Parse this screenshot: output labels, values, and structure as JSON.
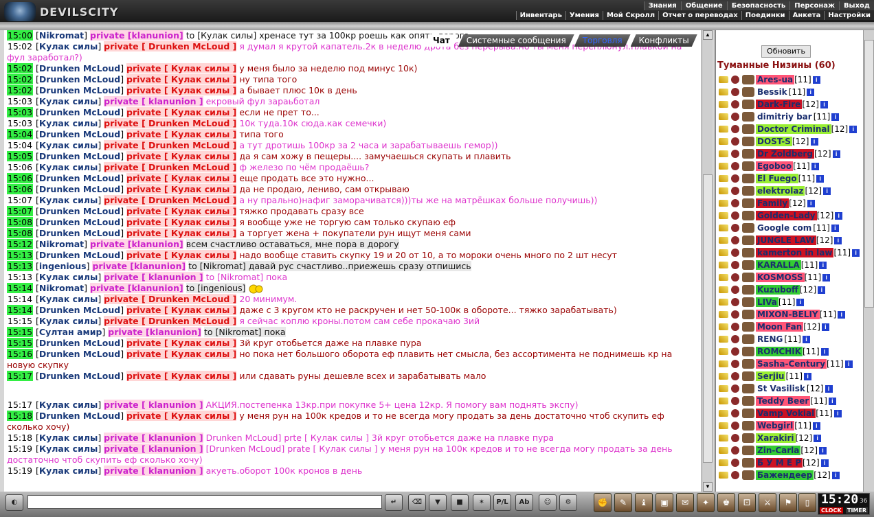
{
  "app": {
    "title": "DEVILSCITY"
  },
  "menu_top": [
    "Знания",
    "Общение",
    "Безопасность",
    "Персонаж",
    "Выход"
  ],
  "menu_sub": [
    "Инвентарь",
    "Умения",
    "Мой Скролл",
    "Отчет о переводах",
    "Поединки",
    "Анкета",
    "Настройки"
  ],
  "tabs": [
    {
      "label": "Чат",
      "active": true
    },
    {
      "label": "Системные сообщения",
      "active": false
    },
    {
      "label": "Торговля",
      "active": false
    },
    {
      "label": "Конфликты",
      "active": false
    }
  ],
  "chat": [
    {
      "time": "15:00",
      "g": 1,
      "name": "Nikromat",
      "priv": "private [klanunion]",
      "pc": "pm",
      "msg": "to [Кулак силы] хренасе тут за 100кр роешь как опять дорога",
      "mc": "m3"
    },
    {
      "time": "15:02",
      "g": 0,
      "name": "Кулак силы",
      "priv": "private [ Drunken McLoud ]",
      "pc": "p",
      "msg": "я думал я крутой капатель.2к в неделю дрота без перерыва.но ты меня переплюнул.плавкой на фул заработал?)",
      "mc": "m2"
    },
    {
      "time": "15:02",
      "g": 1,
      "name": "Drunken McLoud",
      "priv": "private [ Кулак силы ]",
      "pc": "p",
      "msg": "у меня было за неделю под минус 10к)",
      "mc": "m1"
    },
    {
      "time": "15:02",
      "g": 1,
      "name": "Drunken McLoud",
      "priv": "private [ Кулак силы ]",
      "pc": "p",
      "msg": "ну типа того",
      "mc": "m1"
    },
    {
      "time": "15:02",
      "g": 1,
      "name": "Drunken McLoud",
      "priv": "private [ Кулак силы ]",
      "pc": "p",
      "msg": "а бывает плюс 10к в день",
      "mc": "m1"
    },
    {
      "time": "15:03",
      "g": 0,
      "name": "Кулак силы",
      "priv": "private [ klanunion ]",
      "pc": "pm",
      "msg": "екровый фул зараьботал",
      "mc": "m2"
    },
    {
      "time": "15:03",
      "g": 1,
      "name": "Drunken McLoud",
      "priv": "private [ Кулак силы ]",
      "pc": "p",
      "msg": "если не прет то...",
      "mc": "m1"
    },
    {
      "time": "15:03",
      "g": 0,
      "name": "Кулак силы",
      "priv": "private [ Drunken McLoud ]",
      "pc": "p",
      "msg": "10к туда.10к сюда.как семечки)",
      "mc": "m2"
    },
    {
      "time": "15:04",
      "g": 1,
      "name": "Drunken McLoud",
      "priv": "private [ Кулак силы ]",
      "pc": "p",
      "msg": "типа того",
      "mc": "m1"
    },
    {
      "time": "15:04",
      "g": 0,
      "name": "Кулак силы",
      "priv": "private [ Drunken McLoud ]",
      "pc": "p",
      "msg": "а тут дротишь 100кр за 2 часа и зарабатываешь гемор))",
      "mc": "m2"
    },
    {
      "time": "15:05",
      "g": 1,
      "name": "Drunken McLoud",
      "priv": "private [ Кулак силы ]",
      "pc": "p",
      "msg": "да я сам хожу в пещеры.... замучаешься скупать и плавить",
      "mc": "m1"
    },
    {
      "time": "15:06",
      "g": 0,
      "name": "Кулак силы",
      "priv": "private [ Drunken McLoud ]",
      "pc": "p",
      "msg": "ф железо по чём продаёшь?",
      "mc": "m2"
    },
    {
      "time": "15:06",
      "g": 1,
      "name": "Drunken McLoud",
      "priv": "private [ Кулак силы ]",
      "pc": "p",
      "msg": "еще продать все это нужно...",
      "mc": "m1"
    },
    {
      "time": "15:06",
      "g": 1,
      "name": "Drunken McLoud",
      "priv": "private [ Кулак силы ]",
      "pc": "p",
      "msg": "да не продаю, лениво, сам открываю",
      "mc": "m1"
    },
    {
      "time": "15:07",
      "g": 0,
      "name": "Кулак силы",
      "priv": "private [ Drunken McLoud ]",
      "pc": "p",
      "msg": "а ну прально)нафиг заморачиватся)))ты же на матрёшках больше получишь))",
      "mc": "m2"
    },
    {
      "time": "15:07",
      "g": 1,
      "name": "Drunken McLoud",
      "priv": "private [ Кулак силы ]",
      "pc": "p",
      "msg": "тяжко продавать сразу все",
      "mc": "m1"
    },
    {
      "time": "15:08",
      "g": 1,
      "name": "Drunken McLoud",
      "priv": "private [ Кулак силы ]",
      "pc": "p",
      "msg": "я вообще уже не торгую сам только скупаю еф",
      "mc": "m1"
    },
    {
      "time": "15:08",
      "g": 1,
      "name": "Drunken McLoud",
      "priv": "private [ Кулак силы ]",
      "pc": "p",
      "msg": "а торгует жена + покупатели рун ищут меня сами",
      "mc": "m1"
    },
    {
      "time": "15:12",
      "g": 1,
      "name": "Nikromat",
      "priv": "private [klanunion]",
      "pc": "pm",
      "msg": "всем счастливо оставаться, мне пора в дорогу",
      "mc": "m3",
      "hl": 1
    },
    {
      "time": "15:13",
      "g": 1,
      "name": "Drunken McLoud",
      "priv": "private [ Кулак силы ]",
      "pc": "p",
      "msg": "надо вообще ставить скупку 19 и 20 от 10, а то мороки очень много по 2 шт несут",
      "mc": "m1"
    },
    {
      "time": "15:13",
      "g": 1,
      "name": "ingenious",
      "priv": "private [klanunion]",
      "pc": "pm",
      "msg": "to [Nikromat] давай рус счастливо..приежешь сразу отпишись",
      "mc": "m3",
      "hl": 1
    },
    {
      "time": "15:13",
      "g": 0,
      "name": "Кулак силы",
      "priv": "private [ klanunion ]",
      "pc": "pm",
      "msg": "to [Nikromat] пока",
      "mc": "m2"
    },
    {
      "time": "15:14",
      "g": 1,
      "name": "Nikromat",
      "priv": "private [klanunion]",
      "pc": "pm",
      "msg": "to [ingenious]",
      "mc": "m3",
      "hl": 1,
      "smile": 1
    },
    {
      "time": "15:14",
      "g": 0,
      "name": "Кулак силы",
      "priv": "private [ Drunken McLoud ]",
      "pc": "p",
      "msg": "20 минимум.",
      "mc": "m2"
    },
    {
      "time": "15:14",
      "g": 1,
      "name": "Drunken McLoud",
      "priv": "private [ Кулак силы ]",
      "pc": "p",
      "msg": "даже с 3 кругом кто не раскручен и нет 50-100к в обороте... тяжко зарабатывать)",
      "mc": "m1"
    },
    {
      "time": "15:15",
      "g": 0,
      "name": "Кулак силы",
      "priv": "private [ Drunken McLoud ]",
      "pc": "p",
      "msg": "я сейчас коплю кроны.потом сам себе прокачаю 3ий",
      "mc": "m2"
    },
    {
      "time": "15:15",
      "g": 1,
      "name": "Султан амир",
      "priv": "private [klanunion]",
      "pc": "pm",
      "msg": "to [Nikromat] пока",
      "mc": "m3",
      "hl": 1
    },
    {
      "time": "15:15",
      "g": 1,
      "name": "Drunken McLoud",
      "priv": "private [ Кулак силы ]",
      "pc": "p",
      "msg": "3й круг отобьется даже на плавке пура",
      "mc": "m1"
    },
    {
      "time": "15:16",
      "g": 1,
      "name": "Drunken McLoud",
      "priv": "private [ Кулак силы ]",
      "pc": "p",
      "msg": "но пока нет большого оборота еф плавить нет смысла, без ассортимента не поднимешь кр на новую скупку",
      "mc": "m1"
    },
    {
      "time": "15:17",
      "g": 1,
      "name": "Drunken McLoud",
      "priv": "private [ Кулак силы ]",
      "pc": "p",
      "msg": "или сдавать руны дешевле всех и зарабатывать мало",
      "mc": "m1",
      "gap": 1
    },
    {
      "time": "15:17",
      "g": 0,
      "name": "Кулак силы",
      "priv": "private [ klanunion ]",
      "pc": "pm",
      "msg": "АКЦИЯ.постепенка 13кр.при покупке 5+ цена 12кр.        Я помогу вам поднять экспу)",
      "mc": "m2"
    },
    {
      "time": "15:18",
      "g": 1,
      "name": "Drunken McLoud",
      "priv": "private [ Кулак силы ]",
      "pc": "p",
      "msg": "у меня рун на 100к кредов и то не всегда могу продать за день достаточно чтоб скупить еф сколько хочу)",
      "mc": "m1"
    },
    {
      "time": "15:18",
      "g": 0,
      "name": "Кулак силы",
      "priv": "private [ klanunion ]",
      "pc": "pm",
      "msg": "Drunken McLoud] prte [ Кулак силы ] 3й круг отобьется даже на плавке пура",
      "mc": "m2"
    },
    {
      "time": "15:19",
      "g": 0,
      "name": "Кулак силы",
      "priv": "private [ klanunion ]",
      "pc": "pm",
      "msg": "[Drunken McLoud] prate [ Кулак силы ] у меня рун на 100к кредов и то не всегда могу продать за день достаточно чтоб скупить еф сколько хочу)",
      "mc": "m2"
    },
    {
      "time": "15:19",
      "g": 0,
      "name": "Кулак силы",
      "priv": "private [ klanunion ]",
      "pc": "pm",
      "msg": "акуеть.оборот 100к кронов в день",
      "mc": "m2"
    }
  ],
  "side": {
    "refresh_label": "Обновить",
    "location": "Туманные Низины (60)",
    "users": [
      {
        "name": "Ares-ua",
        "lvl": "[11]",
        "bg": "#ff5577"
      },
      {
        "name": "Bessik",
        "lvl": "[11]",
        "bg": ""
      },
      {
        "name": "Dark-Fire",
        "lvl": "[12]",
        "bg": "#cc1122"
      },
      {
        "name": "dimitriy bar",
        "lvl": "[11]",
        "bg": ""
      },
      {
        "name": "Doctor Criminal",
        "lvl": "[12]",
        "bg": "#99ee33"
      },
      {
        "name": "DOST-S",
        "lvl": "[12]",
        "bg": "#99ee33"
      },
      {
        "name": "Dr Zoldberg",
        "lvl": "[12]",
        "bg": "#cc1122"
      },
      {
        "name": "Egoboo",
        "lvl": "[11]",
        "bg": "#ff5577"
      },
      {
        "name": "El Fuego",
        "lvl": "[11]",
        "bg": "#99ee33"
      },
      {
        "name": "elektrolaz",
        "lvl": "[12]",
        "bg": "#99ee33"
      },
      {
        "name": "Family",
        "lvl": "[12]",
        "bg": "#cc1122"
      },
      {
        "name": "Golden-Lady",
        "lvl": "[12]",
        "bg": "#cc1122"
      },
      {
        "name": "Google com",
        "lvl": "[11]",
        "bg": ""
      },
      {
        "name": "JUNGLE LAW",
        "lvl": "[12]",
        "bg": "#cc1122"
      },
      {
        "name": "kamerton in law",
        "lvl": "[11]",
        "bg": "#cc1122"
      },
      {
        "name": "KARALLA",
        "lvl": "[11]",
        "bg": "#33cc33"
      },
      {
        "name": "KOSMOSS",
        "lvl": "[11]",
        "bg": "#ff5577"
      },
      {
        "name": "Kuzuboff",
        "lvl": "[12]",
        "bg": "#33cc33"
      },
      {
        "name": "LIVa",
        "lvl": "[11]",
        "bg": "#33cc33"
      },
      {
        "name": "MIXON-BELIY",
        "lvl": "[11]",
        "bg": "#ff5577"
      },
      {
        "name": "Moon Fan",
        "lvl": "[12]",
        "bg": "#ff5577"
      },
      {
        "name": "RENG",
        "lvl": "[11]",
        "bg": ""
      },
      {
        "name": "ROMCHIK",
        "lvl": "[11]",
        "bg": "#33cc33"
      },
      {
        "name": "Sasha-Century",
        "lvl": "[11]",
        "bg": "#ff5577"
      },
      {
        "name": "Serjiu",
        "lvl": "[11]",
        "bg": "#99ee33"
      },
      {
        "name": "St Vasilisk",
        "lvl": "[12]",
        "bg": ""
      },
      {
        "name": "Teddy Beer",
        "lvl": "[11]",
        "bg": "#ff5577"
      },
      {
        "name": "Vamp Vokial",
        "lvl": "[11]",
        "bg": "#cc1122"
      },
      {
        "name": "Webgirl",
        "lvl": "[11]",
        "bg": "#ff5577"
      },
      {
        "name": "Xarakiri",
        "lvl": "[12]",
        "bg": "#99ee33"
      },
      {
        "name": "Zin-Carla",
        "lvl": "[12]",
        "bg": "#33cc33"
      },
      {
        "name": "Б У М Е Р",
        "lvl": "[12]",
        "bg": "#cc1122"
      },
      {
        "name": "Бажендеер",
        "lvl": "[12]",
        "bg": "#33cc33"
      }
    ]
  },
  "clock": {
    "time": "15:20",
    "sec": "36",
    "clock_label": "CLOCK",
    "timer_label": "TIMER"
  }
}
